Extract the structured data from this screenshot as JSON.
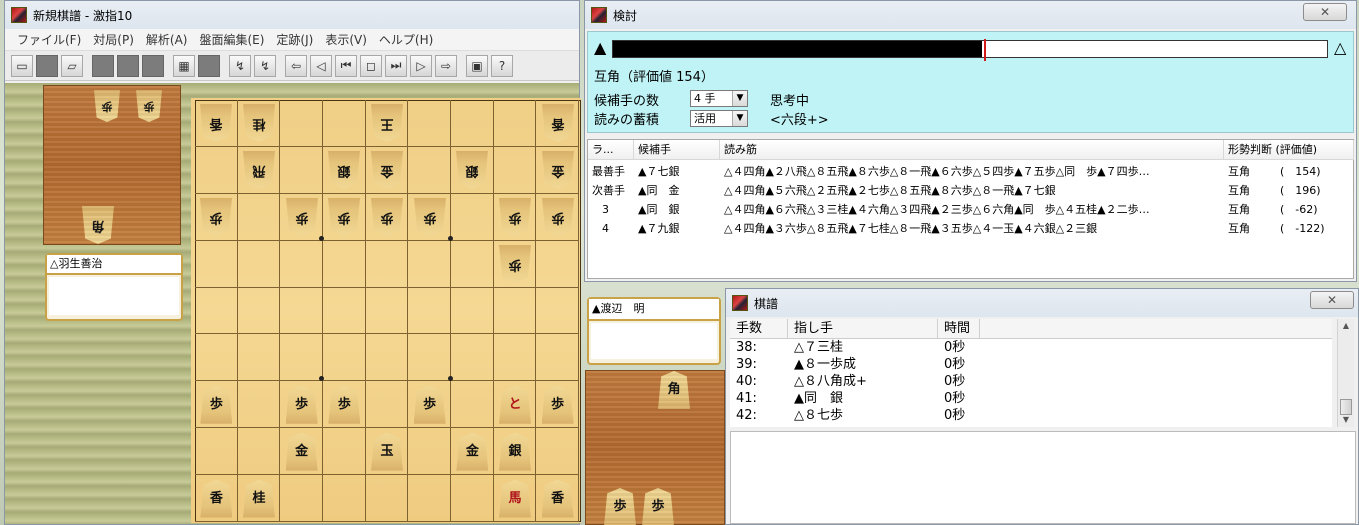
{
  "main_window": {
    "title": "新規棋譜 - 激指10",
    "menu": [
      "ファイル(F)",
      "対局(P)",
      "解析(A)",
      "盤面編集(E)",
      "定跡(J)",
      "表示(V)",
      "ヘルプ(H)"
    ]
  },
  "players": {
    "gote": "△羽生善治",
    "sente": "▲渡辺　明"
  },
  "hands": {
    "gote": [
      "歩",
      "歩",
      "角"
    ],
    "sente": [
      "角",
      "歩",
      "歩"
    ]
  },
  "board": [
    [
      "香",
      "桂",
      "",
      "",
      "王",
      "",
      "",
      "",
      "香"
    ],
    [
      "",
      "飛",
      "",
      "銀",
      "金",
      "",
      "銀",
      "",
      "金"
    ],
    [
      "歩",
      "",
      "歩",
      "歩",
      "歩",
      "歩",
      "",
      "歩",
      "歩"
    ],
    [
      "",
      "",
      "",
      "",
      "",
      "",
      "",
      "歩",
      ""
    ],
    [
      "",
      "",
      "",
      "",
      "",
      "",
      "",
      "",
      ""
    ],
    [
      "",
      "",
      "",
      "",
      "",
      "",
      "",
      "",
      ""
    ],
    [
      "歩",
      "",
      "歩",
      "歩",
      "",
      "歩",
      "",
      "と",
      "歩"
    ],
    [
      "",
      "",
      "金",
      "",
      "玉",
      "",
      "金",
      "銀",
      ""
    ],
    [
      "香",
      "桂",
      "",
      "",
      "",
      "",
      "",
      "馬",
      "香"
    ]
  ],
  "kento": {
    "title": "検討",
    "close": "✕",
    "eval_fraction": 0.517,
    "marker_fraction": 0.52,
    "left_mark": "▲",
    "right_mark": "△",
    "status": "互角（評価値 154）",
    "candidates_label": "候補手の数",
    "candidates_value": "4 手",
    "thinking": "思考中",
    "hash_label": "読みの蓄積",
    "hash_value": "活用",
    "level": "<六段+>",
    "columns": [
      "ラ...",
      "候補手",
      "読み筋",
      "形勢判断 (評価値)"
    ],
    "rows": [
      {
        "rank": "最善手",
        "move": "▲７七銀",
        "line": "△４四角▲２八飛△８五飛▲８六歩△８一飛▲６六歩△５四歩▲７五歩△同　歩▲７四歩…",
        "judge": "互角",
        "value": "(　154)"
      },
      {
        "rank": "次善手",
        "move": "▲同　金",
        "line": "△４四角▲５六飛△２五飛▲２七歩△８五飛▲８六歩△８一飛▲７七銀",
        "judge": "互角",
        "value": "(　196)"
      },
      {
        "rank": "3",
        "move": "▲同　銀",
        "line": "△４四角▲６六飛△３三桂▲４六角△３四飛▲２三歩△６六角▲同　歩△４五桂▲２二歩…",
        "judge": "互角",
        "value": "(　-62)"
      },
      {
        "rank": "4",
        "move": "▲７九銀",
        "line": "△４四角▲３六歩△８五飛▲７七桂△８一飛▲３五歩△４一玉▲４六銀△２三銀",
        "judge": "互角",
        "value": "(　-122)"
      }
    ]
  },
  "kifu": {
    "title": "棋譜",
    "close": "✕",
    "columns": [
      "手数",
      "指し手",
      "時間"
    ],
    "rows": [
      {
        "num": "38:",
        "move": "△７三桂",
        "time": "0秒"
      },
      {
        "num": "39:",
        "move": "▲８一歩成",
        "time": "0秒"
      },
      {
        "num": "40:",
        "move": "△８八角成+",
        "time": "0秒"
      },
      {
        "num": "41:",
        "move": "▲同　銀",
        "time": "0秒"
      },
      {
        "num": "42:",
        "move": "△８七歩",
        "time": "0秒"
      }
    ]
  },
  "colors": {
    "eval_bar": "#000000",
    "eval_marker": "#d21c1c",
    "kento_bg": "#bff3f6"
  }
}
